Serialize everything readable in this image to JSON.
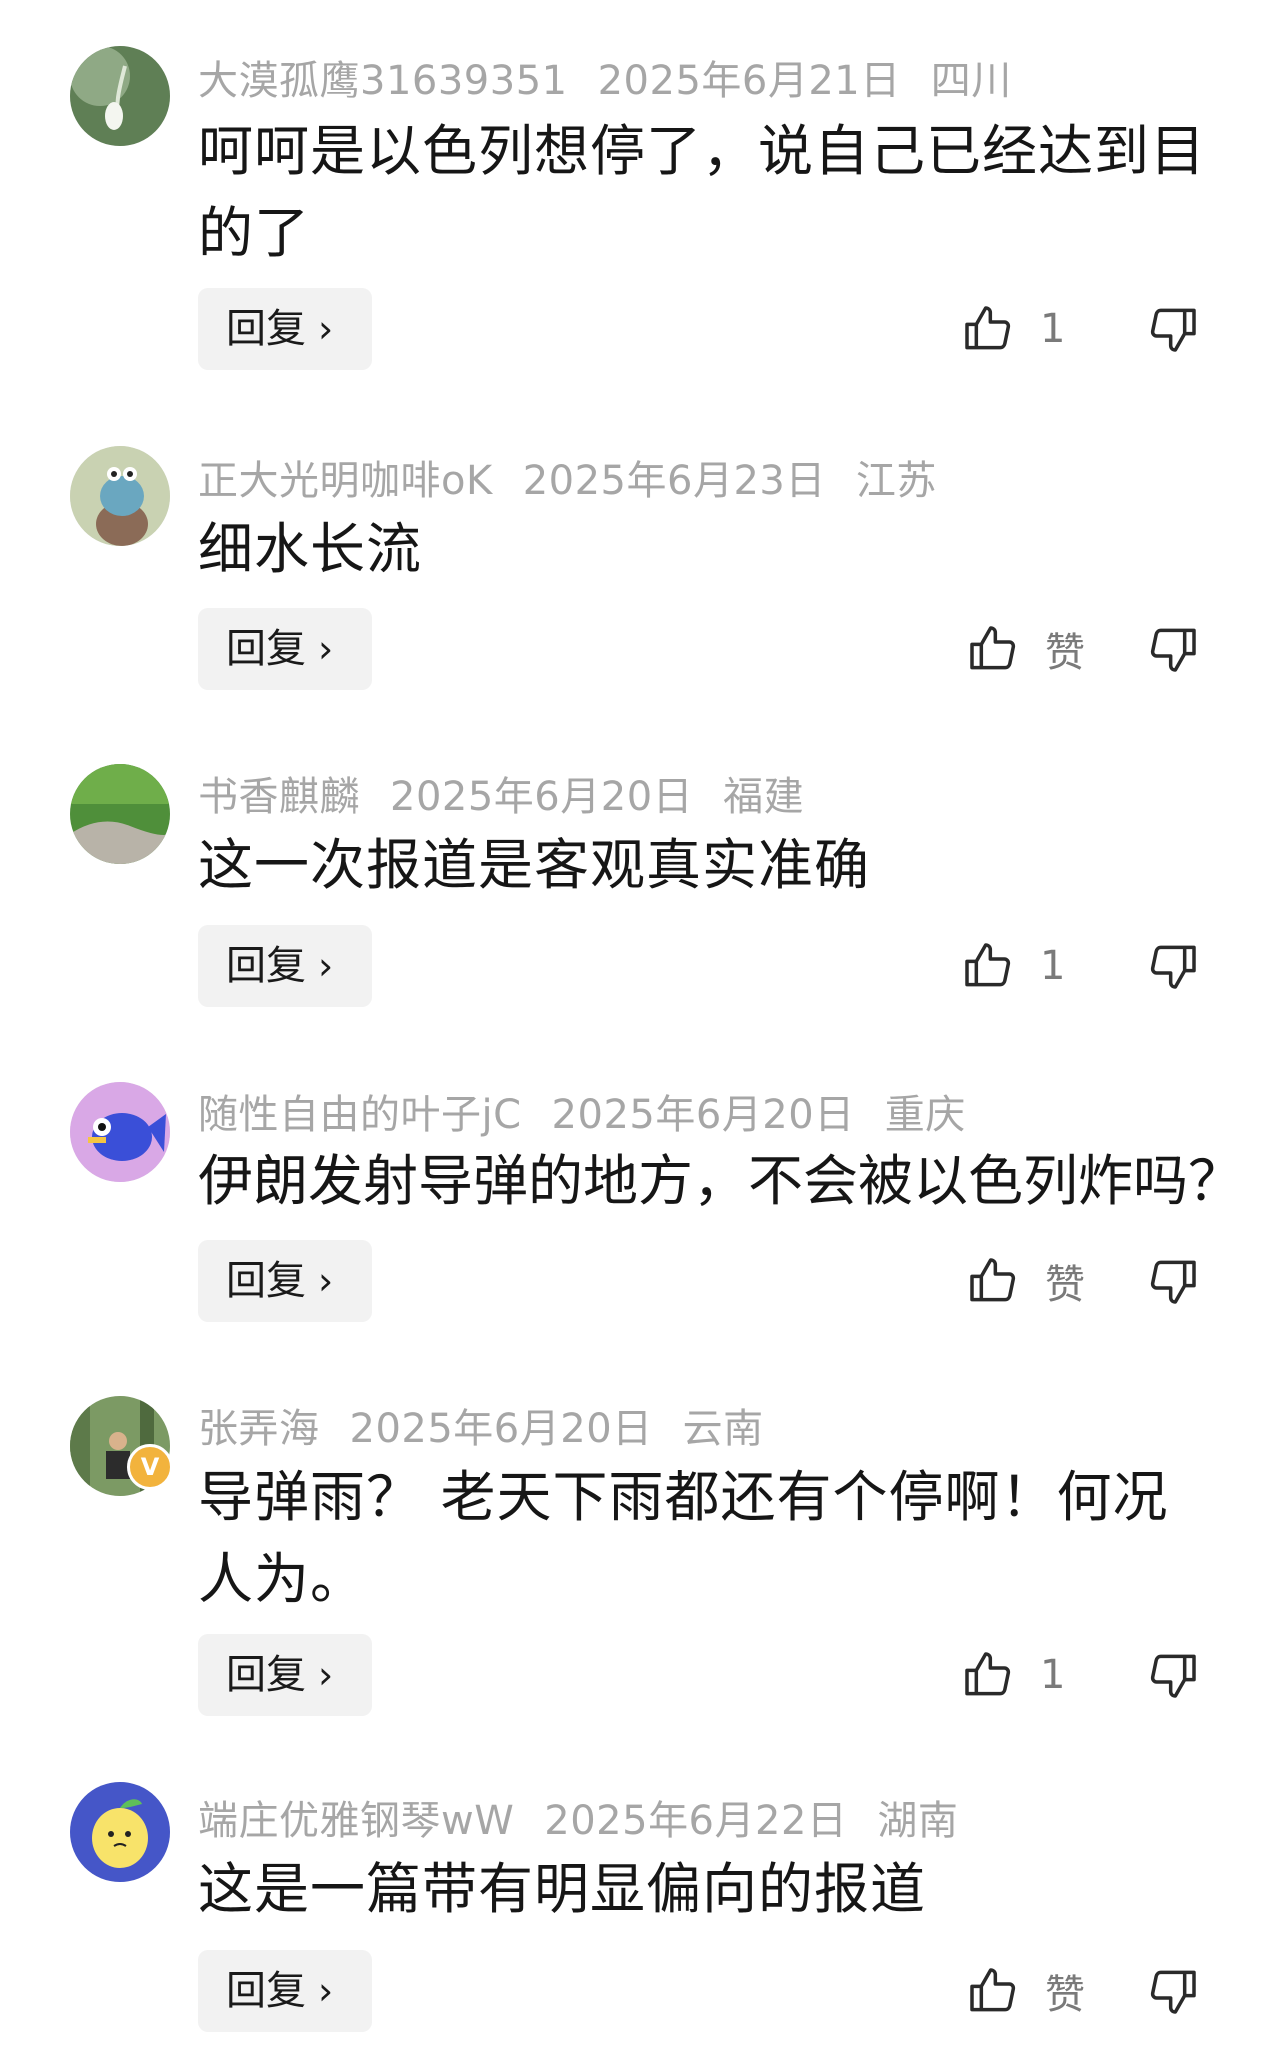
{
  "comments": [
    {
      "user": "大漠孤鹰31639351",
      "date": "2025年6月21日",
      "region": "四川",
      "text": "呵呵是以色列想停了，说自己已经达到目的了",
      "reply": "回复",
      "likes": "1"
    },
    {
      "user": "正大光明咖啡oK",
      "date": "2025年6月23日",
      "region": "江苏",
      "text": "细水长流",
      "reply": "回复",
      "likes": "赞"
    },
    {
      "user": "书香麒麟",
      "date": "2025年6月20日",
      "region": "福建",
      "text": "这一次报道是客观真实准确",
      "reply": "回复",
      "likes": "1"
    },
    {
      "user": "随性自由的叶子jC",
      "date": "2025年6月20日",
      "region": "重庆",
      "text": "伊朗发射导弹的地方，不会被以色列炸吗？",
      "reply": "回复",
      "likes": "赞"
    },
    {
      "user": "张弄海",
      "date": "2025年6月20日",
      "region": "云南",
      "text": "导弹雨？ 老天下雨都还有个停啊！何况人为。",
      "reply": "回复",
      "likes": "1",
      "badge": "V"
    },
    {
      "user": "端庄优雅钢琴wW",
      "date": "2025年6月22日",
      "region": "湖南",
      "text": "这是一篇带有明显偏向的报道",
      "reply": "回复",
      "likes": "赞"
    }
  ],
  "icons": {
    "like": "thumbs-up-icon",
    "dislike": "thumbs-down-icon",
    "reply_arrow": "chevron-right-icon"
  },
  "colors": {
    "meta": "#a6a6a6",
    "text": "#161616",
    "reply_bg": "#f2f2f2"
  }
}
